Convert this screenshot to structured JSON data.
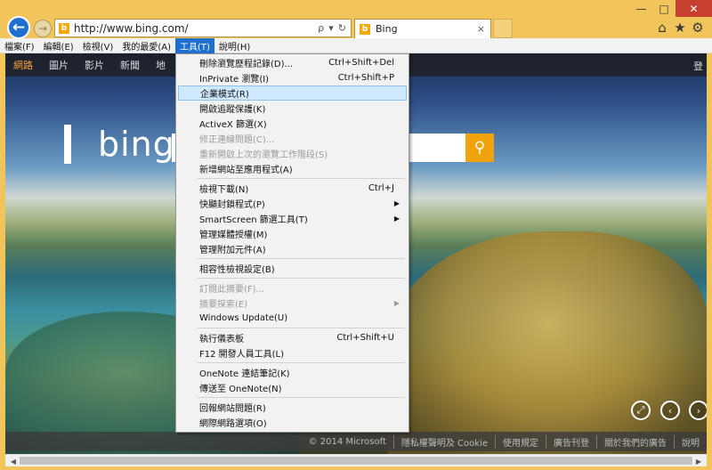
{
  "window": {
    "min_label": "—",
    "max_label": "□",
    "close_label": "✕"
  },
  "address": {
    "url": "http://www.bing.com/",
    "search_label": "ρ",
    "dropdown_label": "▾",
    "refresh_label": "↻"
  },
  "tab": {
    "title": "Bing",
    "close_label": "×"
  },
  "menubar": [
    {
      "label": "檔案(F)"
    },
    {
      "label": "編輯(E)"
    },
    {
      "label": "檢視(V)"
    },
    {
      "label": "我的最愛(A)"
    },
    {
      "label": "工具(T)"
    },
    {
      "label": "說明(H)"
    }
  ],
  "page": {
    "nav": [
      "網路",
      "圖片",
      "影片",
      "新聞",
      "地"
    ],
    "signin": "登",
    "logo_text": "bing",
    "footer": [
      "© 2014 Microsoft",
      "隱私權聲明及 Cookie",
      "使用規定",
      "廣告刊登",
      "關於我們的廣告",
      "說明"
    ]
  },
  "tools_menu": {
    "groups": [
      [
        {
          "label": "刪除瀏覽歷程記錄(D)...",
          "shortcut": "Ctrl+Shift+Del"
        },
        {
          "label": "InPrivate 瀏覽(I)",
          "shortcut": "Ctrl+Shift+P"
        },
        {
          "label": "企業模式(R)",
          "highlighted": true
        },
        {
          "label": "開啟追蹤保護(K)"
        },
        {
          "label": "ActiveX 篩選(X)"
        },
        {
          "label": "修正連線問題(C)...",
          "disabled": true
        },
        {
          "label": "重新開啟上次的瀏覽工作階段(S)",
          "disabled": true
        },
        {
          "label": "新增網站至應用程式(A)"
        }
      ],
      [
        {
          "label": "檢視下載(N)",
          "shortcut": "Ctrl+J"
        },
        {
          "label": "快顯封鎖程式(P)",
          "submenu": true
        },
        {
          "label": "SmartScreen 篩選工具(T)",
          "submenu": true
        },
        {
          "label": "管理媒體授權(M)"
        },
        {
          "label": "管理附加元件(A)"
        }
      ],
      [
        {
          "label": "相容性檢視設定(B)"
        }
      ],
      [
        {
          "label": "訂閱此摘要(F)...",
          "disabled": true
        },
        {
          "label": "摘要探索(E)",
          "disabled": true,
          "submenu": true
        },
        {
          "label": "Windows Update(U)"
        }
      ],
      [
        {
          "label": "執行儀表板",
          "shortcut": "Ctrl+Shift+U"
        },
        {
          "label": "F12 開發人員工具(L)"
        }
      ],
      [
        {
          "label": "OneNote 連結筆記(K)"
        },
        {
          "label": "傳送至 OneNote(N)"
        }
      ],
      [
        {
          "label": "回報網站問題(R)"
        },
        {
          "label": "網際網路選項(O)"
        }
      ]
    ]
  }
}
